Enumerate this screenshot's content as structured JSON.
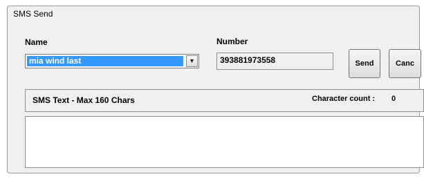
{
  "window": {
    "title": "SMS Send"
  },
  "form": {
    "name_label": "Name",
    "name_value": "mia wind last",
    "number_label": "Number",
    "number_value": "393881973558",
    "send_label": "Send",
    "cancel_label": "Canc"
  },
  "sms": {
    "label": "SMS Text  - Max 160 Chars",
    "char_count_label": "Character count :",
    "char_count_value": "0",
    "text": ""
  }
}
